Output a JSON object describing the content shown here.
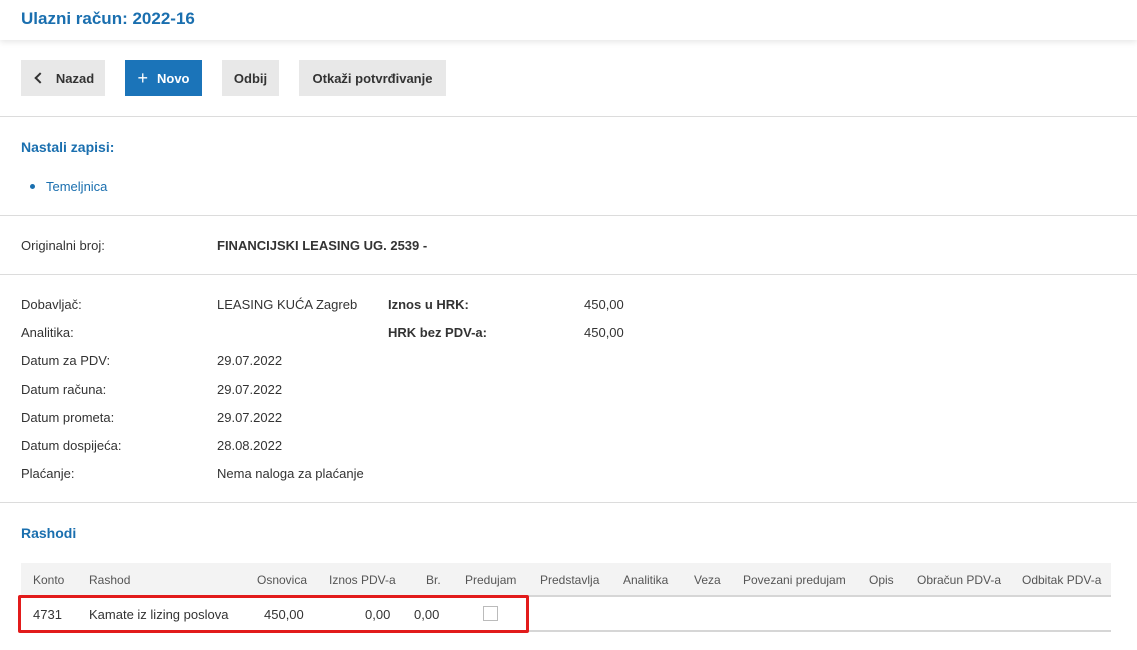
{
  "header": {
    "title": "Ulazni račun: 2022-16"
  },
  "toolbar": {
    "back_label": "Nazad",
    "new_label": "Novo",
    "deduct_label": "Odbij",
    "cancel_confirm_label": "Otkaži potvrđivanje"
  },
  "records": {
    "title": "Nastali zapisi:",
    "items": [
      "Temeljnica"
    ]
  },
  "original": {
    "label": "Originalni broj:",
    "value": "FINANCIJSKI LEASING UG. 2539 -"
  },
  "details": {
    "supplier_label": "Dobavljač:",
    "supplier_value": "LEASING KUĆA Zagreb",
    "analytics_label": "Analitika:",
    "analytics_value": "",
    "vat_date_label": "Datum za PDV:",
    "vat_date_value": "29.07.2022",
    "invoice_date_label": "Datum računa:",
    "invoice_date_value": "29.07.2022",
    "turnover_date_label": "Datum prometa:",
    "turnover_date_value": "29.07.2022",
    "due_date_label": "Datum dospijeća:",
    "due_date_value": "28.08.2022",
    "payment_label": "Plaćanje:",
    "payment_value": "Nema naloga za plaćanje",
    "amount_hrk_label": "Iznos u HRK:",
    "amount_hrk_value": "450,00",
    "hrk_no_vat_label": "HRK bez PDV-a:",
    "hrk_no_vat_value": "450,00"
  },
  "expenses": {
    "title": "Rashodi",
    "columns": [
      "Konto",
      "Rashod",
      "Osnovica",
      "Iznos PDV-a",
      "Br.",
      "Predujam",
      "Predstavlja",
      "Analitika",
      "Veza",
      "Povezani predujam",
      "Opis",
      "Obračun PDV-a",
      "Odbitak PDV-a"
    ],
    "rows": [
      {
        "konto": "4731",
        "rashod": "Kamate iz lizing poslova",
        "osnovica": "450,00",
        "iznos_pdv": "0,00",
        "br": "0,00",
        "predujam": false
      }
    ]
  },
  "colors": {
    "accent": "#1a6faf",
    "primary_button": "#1b74b9",
    "highlight": "#e21b1b"
  }
}
